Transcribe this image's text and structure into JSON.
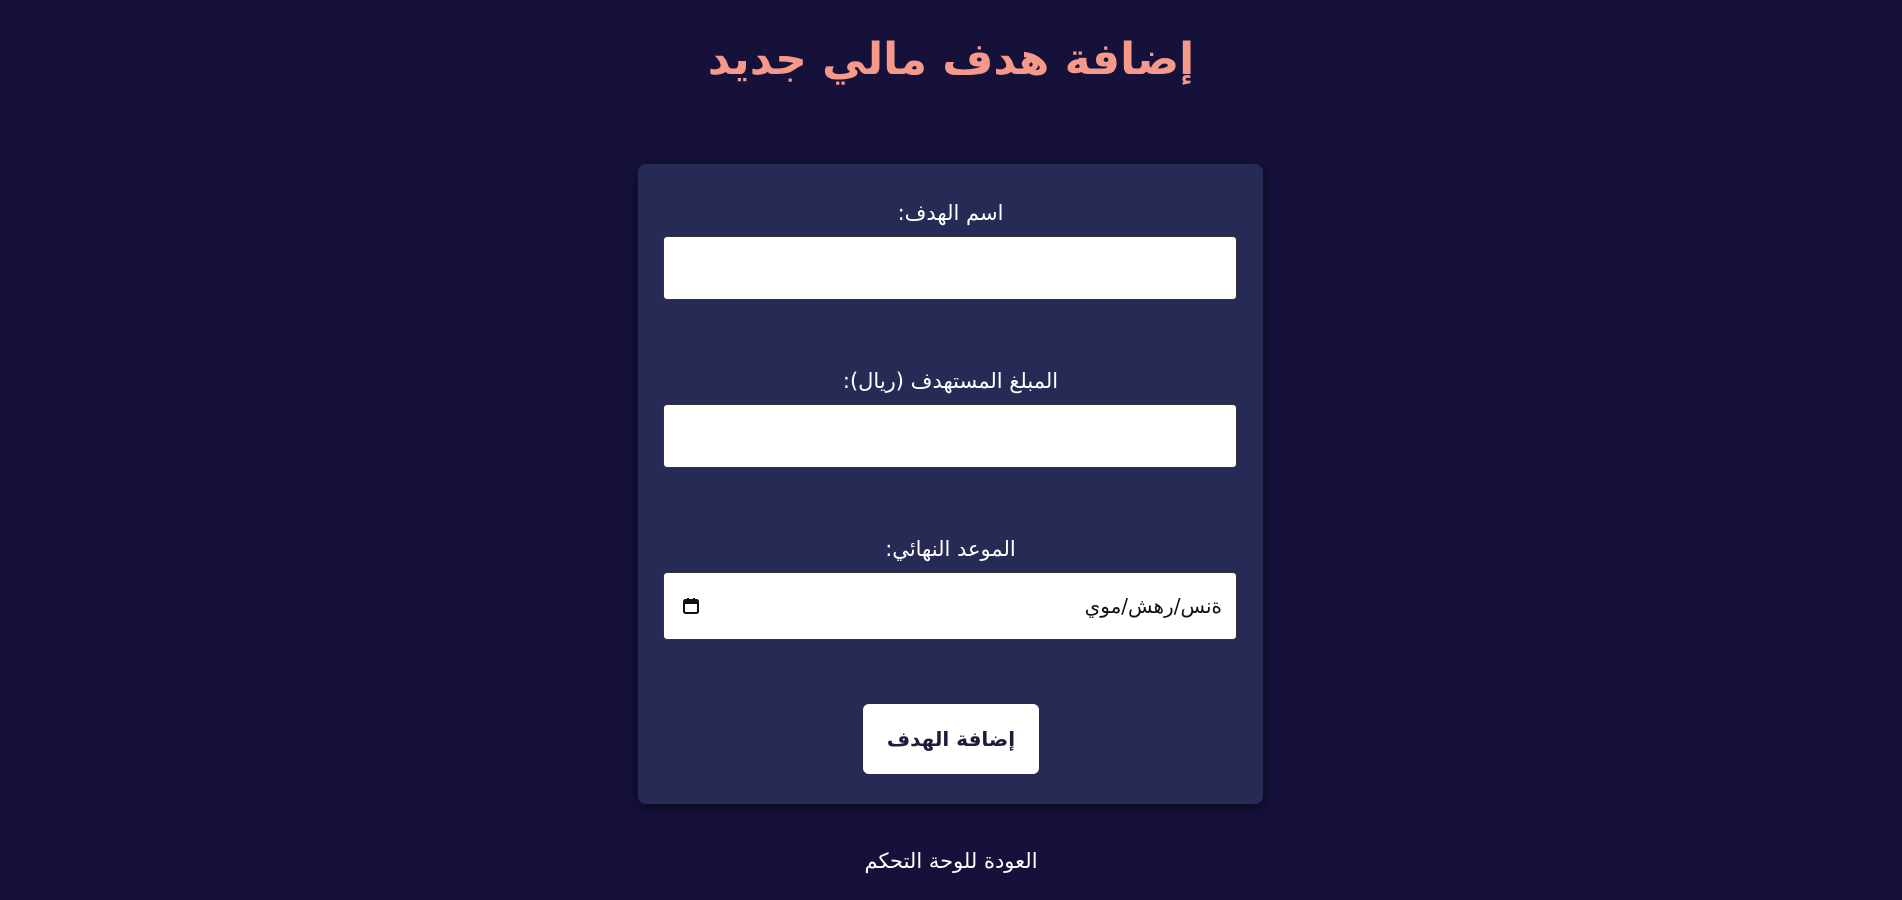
{
  "page": {
    "title": "إضافة هدف مالي جديد"
  },
  "form": {
    "goal_name": {
      "label": "اسم الهدف:",
      "value": ""
    },
    "target_amount": {
      "label": "المبلغ المستهدف (ريال):",
      "value": ""
    },
    "deadline": {
      "label": "الموعد النهائي:",
      "display": "ةنس/رهش/موي",
      "icon": "calendar-icon"
    },
    "submit_label": "إضافة الهدف"
  },
  "footer": {
    "back_link_label": "العودة للوحة التحكم"
  },
  "colors": {
    "background": "#15113a",
    "card": "#272a55",
    "title_accent": "#f59a8a",
    "button_text": "#1c1c3c"
  }
}
